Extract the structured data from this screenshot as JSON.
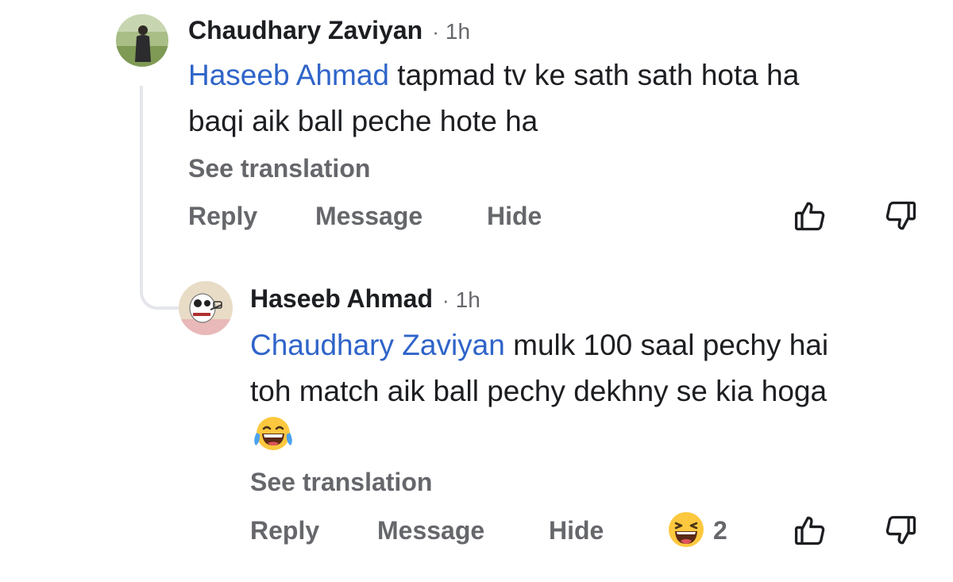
{
  "comments": [
    {
      "author": "Chaudhary Zaviyan",
      "time": "1h",
      "mention": "Haseeb Ahmad",
      "text_line1": "tapmad tv ke sath sath hota ha",
      "text_line2": "baqi aik ball peche hote ha",
      "see_translation": "See translation",
      "actions": {
        "reply": "Reply",
        "message": "Message",
        "hide": "Hide"
      }
    },
    {
      "author": "Haseeb Ahmad",
      "time": "1h",
      "mention": "Chaudhary Zaviyan",
      "text_line1": "mulk 100 saal pechy hai",
      "text_line2": "toh match aik ball pechy dekhny se kia hoga",
      "emoji": "laughing-with-tears",
      "see_translation": "See translation",
      "actions": {
        "reply": "Reply",
        "message": "Message",
        "hide": "Hide"
      },
      "reaction": {
        "icon": "haha-reaction-icon",
        "count": "2"
      }
    }
  ],
  "separator": "·",
  "colors": {
    "mention": "#2f64c9",
    "secondary_text": "#65676b",
    "primary_text": "#1c1e21",
    "thread_line": "#e4e6eb"
  }
}
